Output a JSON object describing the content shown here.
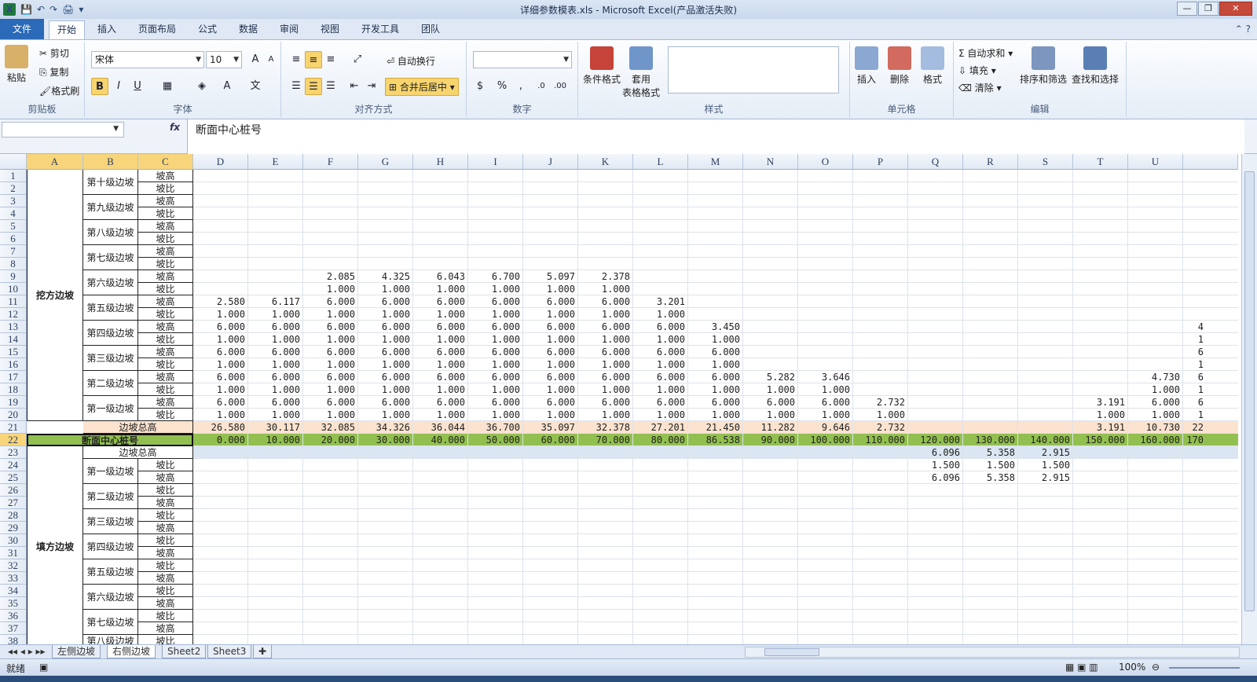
{
  "window": {
    "title": "详细参数模表.xls  -  Microsoft Excel(产品激活失败)"
  },
  "tabs": [
    "文件",
    "开始",
    "插入",
    "页面布局",
    "公式",
    "数据",
    "审阅",
    "视图",
    "开发工具",
    "团队"
  ],
  "ribbon": {
    "clipboard": {
      "name": "剪贴板",
      "paste": "粘贴",
      "cut": "剪切",
      "copy": "复制",
      "format_painter": "格式刷"
    },
    "font": {
      "name": "字体",
      "face": "宋体",
      "size": "10"
    },
    "alignment": {
      "name": "对齐方式",
      "wrap": "自动换行",
      "merge": "合并后居中"
    },
    "number": {
      "name": "数字"
    },
    "styles": {
      "name": "样式",
      "conditional": "条件格式",
      "table_fmt": "套用",
      "table_fmt2": "表格格式"
    },
    "cells": {
      "name": "单元格",
      "insert": "插入",
      "delete": "删除",
      "format": "格式"
    },
    "editing": {
      "name": "编辑",
      "autosum": "自动求和",
      "fill": "填充",
      "clear": "清除",
      "sort": "排序和筛选",
      "find": "查找和选择"
    }
  },
  "formula_bar": {
    "fx": "fx",
    "content": "断面中心桩号"
  },
  "columns": [
    "A",
    "B",
    "C",
    "D",
    "E",
    "F",
    "G",
    "H",
    "I",
    "J",
    "K",
    "L",
    "M",
    "N",
    "O",
    "P",
    "Q",
    "R",
    "S",
    "T",
    "U"
  ],
  "labels": {
    "cut_slope": "挖方边坡",
    "fill_slope": "填方边坡",
    "center_station": "断面中心桩号",
    "total_height": "边坡总高",
    "slope_height": "坡高",
    "slope_ratio": "坡比",
    "cut_levels": [
      "第十级边坡",
      "第九级边坡",
      "第八级边坡",
      "第七级边坡",
      "第六级边坡",
      "第五级边坡",
      "第四级边坡",
      "第三级边坡",
      "第二级边坡",
      "第一级边坡"
    ],
    "fill_levels": [
      "第一级边坡",
      "第二级边坡",
      "第三级边坡",
      "第四级边坡",
      "第五级边坡",
      "第六级边坡",
      "第七级边坡",
      "第八级边坡"
    ]
  },
  "cells": [
    {
      "r": 9,
      "c": "F",
      "v": "2.085"
    },
    {
      "r": 9,
      "c": "G",
      "v": "4.325"
    },
    {
      "r": 9,
      "c": "H",
      "v": "6.043"
    },
    {
      "r": 9,
      "c": "I",
      "v": "6.700"
    },
    {
      "r": 9,
      "c": "J",
      "v": "5.097"
    },
    {
      "r": 9,
      "c": "K",
      "v": "2.378"
    },
    {
      "r": 10,
      "c": "F",
      "v": "1.000"
    },
    {
      "r": 10,
      "c": "G",
      "v": "1.000"
    },
    {
      "r": 10,
      "c": "H",
      "v": "1.000"
    },
    {
      "r": 10,
      "c": "I",
      "v": "1.000"
    },
    {
      "r": 10,
      "c": "J",
      "v": "1.000"
    },
    {
      "r": 10,
      "c": "K",
      "v": "1.000"
    },
    {
      "r": 11,
      "c": "D",
      "v": "2.580"
    },
    {
      "r": 11,
      "c": "E",
      "v": "6.117"
    },
    {
      "r": 11,
      "c": "F",
      "v": "6.000"
    },
    {
      "r": 11,
      "c": "G",
      "v": "6.000"
    },
    {
      "r": 11,
      "c": "H",
      "v": "6.000"
    },
    {
      "r": 11,
      "c": "I",
      "v": "6.000"
    },
    {
      "r": 11,
      "c": "J",
      "v": "6.000"
    },
    {
      "r": 11,
      "c": "K",
      "v": "6.000"
    },
    {
      "r": 11,
      "c": "L",
      "v": "3.201"
    },
    {
      "r": 12,
      "c": "D",
      "v": "1.000"
    },
    {
      "r": 12,
      "c": "E",
      "v": "1.000"
    },
    {
      "r": 12,
      "c": "F",
      "v": "1.000"
    },
    {
      "r": 12,
      "c": "G",
      "v": "1.000"
    },
    {
      "r": 12,
      "c": "H",
      "v": "1.000"
    },
    {
      "r": 12,
      "c": "I",
      "v": "1.000"
    },
    {
      "r": 12,
      "c": "J",
      "v": "1.000"
    },
    {
      "r": 12,
      "c": "K",
      "v": "1.000"
    },
    {
      "r": 12,
      "c": "L",
      "v": "1.000"
    },
    {
      "r": 13,
      "c": "D",
      "v": "6.000"
    },
    {
      "r": 13,
      "c": "E",
      "v": "6.000"
    },
    {
      "r": 13,
      "c": "F",
      "v": "6.000"
    },
    {
      "r": 13,
      "c": "G",
      "v": "6.000"
    },
    {
      "r": 13,
      "c": "H",
      "v": "6.000"
    },
    {
      "r": 13,
      "c": "I",
      "v": "6.000"
    },
    {
      "r": 13,
      "c": "J",
      "v": "6.000"
    },
    {
      "r": 13,
      "c": "K",
      "v": "6.000"
    },
    {
      "r": 13,
      "c": "L",
      "v": "6.000"
    },
    {
      "r": 13,
      "c": "M",
      "v": "3.450"
    },
    {
      "r": 14,
      "c": "D",
      "v": "1.000"
    },
    {
      "r": 14,
      "c": "E",
      "v": "1.000"
    },
    {
      "r": 14,
      "c": "F",
      "v": "1.000"
    },
    {
      "r": 14,
      "c": "G",
      "v": "1.000"
    },
    {
      "r": 14,
      "c": "H",
      "v": "1.000"
    },
    {
      "r": 14,
      "c": "I",
      "v": "1.000"
    },
    {
      "r": 14,
      "c": "J",
      "v": "1.000"
    },
    {
      "r": 14,
      "c": "K",
      "v": "1.000"
    },
    {
      "r": 14,
      "c": "L",
      "v": "1.000"
    },
    {
      "r": 14,
      "c": "M",
      "v": "1.000"
    },
    {
      "r": 15,
      "c": "D",
      "v": "6.000"
    },
    {
      "r": 15,
      "c": "E",
      "v": "6.000"
    },
    {
      "r": 15,
      "c": "F",
      "v": "6.000"
    },
    {
      "r": 15,
      "c": "G",
      "v": "6.000"
    },
    {
      "r": 15,
      "c": "H",
      "v": "6.000"
    },
    {
      "r": 15,
      "c": "I",
      "v": "6.000"
    },
    {
      "r": 15,
      "c": "J",
      "v": "6.000"
    },
    {
      "r": 15,
      "c": "K",
      "v": "6.000"
    },
    {
      "r": 15,
      "c": "L",
      "v": "6.000"
    },
    {
      "r": 15,
      "c": "M",
      "v": "6.000"
    },
    {
      "r": 16,
      "c": "D",
      "v": "1.000"
    },
    {
      "r": 16,
      "c": "E",
      "v": "1.000"
    },
    {
      "r": 16,
      "c": "F",
      "v": "1.000"
    },
    {
      "r": 16,
      "c": "G",
      "v": "1.000"
    },
    {
      "r": 16,
      "c": "H",
      "v": "1.000"
    },
    {
      "r": 16,
      "c": "I",
      "v": "1.000"
    },
    {
      "r": 16,
      "c": "J",
      "v": "1.000"
    },
    {
      "r": 16,
      "c": "K",
      "v": "1.000"
    },
    {
      "r": 16,
      "c": "L",
      "v": "1.000"
    },
    {
      "r": 16,
      "c": "M",
      "v": "1.000"
    },
    {
      "r": 17,
      "c": "D",
      "v": "6.000"
    },
    {
      "r": 17,
      "c": "E",
      "v": "6.000"
    },
    {
      "r": 17,
      "c": "F",
      "v": "6.000"
    },
    {
      "r": 17,
      "c": "G",
      "v": "6.000"
    },
    {
      "r": 17,
      "c": "H",
      "v": "6.000"
    },
    {
      "r": 17,
      "c": "I",
      "v": "6.000"
    },
    {
      "r": 17,
      "c": "J",
      "v": "6.000"
    },
    {
      "r": 17,
      "c": "K",
      "v": "6.000"
    },
    {
      "r": 17,
      "c": "L",
      "v": "6.000"
    },
    {
      "r": 17,
      "c": "M",
      "v": "6.000"
    },
    {
      "r": 17,
      "c": "N",
      "v": "5.282"
    },
    {
      "r": 17,
      "c": "O",
      "v": "3.646"
    },
    {
      "r": 17,
      "c": "U",
      "v": "4.730"
    },
    {
      "r": 18,
      "c": "D",
      "v": "1.000"
    },
    {
      "r": 18,
      "c": "E",
      "v": "1.000"
    },
    {
      "r": 18,
      "c": "F",
      "v": "1.000"
    },
    {
      "r": 18,
      "c": "G",
      "v": "1.000"
    },
    {
      "r": 18,
      "c": "H",
      "v": "1.000"
    },
    {
      "r": 18,
      "c": "I",
      "v": "1.000"
    },
    {
      "r": 18,
      "c": "J",
      "v": "1.000"
    },
    {
      "r": 18,
      "c": "K",
      "v": "1.000"
    },
    {
      "r": 18,
      "c": "L",
      "v": "1.000"
    },
    {
      "r": 18,
      "c": "M",
      "v": "1.000"
    },
    {
      "r": 18,
      "c": "N",
      "v": "1.000"
    },
    {
      "r": 18,
      "c": "O",
      "v": "1.000"
    },
    {
      "r": 18,
      "c": "U",
      "v": "1.000"
    },
    {
      "r": 19,
      "c": "D",
      "v": "6.000"
    },
    {
      "r": 19,
      "c": "E",
      "v": "6.000"
    },
    {
      "r": 19,
      "c": "F",
      "v": "6.000"
    },
    {
      "r": 19,
      "c": "G",
      "v": "6.000"
    },
    {
      "r": 19,
      "c": "H",
      "v": "6.000"
    },
    {
      "r": 19,
      "c": "I",
      "v": "6.000"
    },
    {
      "r": 19,
      "c": "J",
      "v": "6.000"
    },
    {
      "r": 19,
      "c": "K",
      "v": "6.000"
    },
    {
      "r": 19,
      "c": "L",
      "v": "6.000"
    },
    {
      "r": 19,
      "c": "M",
      "v": "6.000"
    },
    {
      "r": 19,
      "c": "N",
      "v": "6.000"
    },
    {
      "r": 19,
      "c": "O",
      "v": "6.000"
    },
    {
      "r": 19,
      "c": "P",
      "v": "2.732"
    },
    {
      "r": 19,
      "c": "T",
      "v": "3.191"
    },
    {
      "r": 19,
      "c": "U",
      "v": "6.000"
    },
    {
      "r": 20,
      "c": "D",
      "v": "1.000"
    },
    {
      "r": 20,
      "c": "E",
      "v": "1.000"
    },
    {
      "r": 20,
      "c": "F",
      "v": "1.000"
    },
    {
      "r": 20,
      "c": "G",
      "v": "1.000"
    },
    {
      "r": 20,
      "c": "H",
      "v": "1.000"
    },
    {
      "r": 20,
      "c": "I",
      "v": "1.000"
    },
    {
      "r": 20,
      "c": "J",
      "v": "1.000"
    },
    {
      "r": 20,
      "c": "K",
      "v": "1.000"
    },
    {
      "r": 20,
      "c": "L",
      "v": "1.000"
    },
    {
      "r": 20,
      "c": "M",
      "v": "1.000"
    },
    {
      "r": 20,
      "c": "N",
      "v": "1.000"
    },
    {
      "r": 20,
      "c": "O",
      "v": "1.000"
    },
    {
      "r": 20,
      "c": "P",
      "v": "1.000"
    },
    {
      "r": 20,
      "c": "T",
      "v": "1.000"
    },
    {
      "r": 20,
      "c": "U",
      "v": "1.000"
    },
    {
      "r": 21,
      "c": "D",
      "v": "26.580"
    },
    {
      "r": 21,
      "c": "E",
      "v": "30.117"
    },
    {
      "r": 21,
      "c": "F",
      "v": "32.085"
    },
    {
      "r": 21,
      "c": "G",
      "v": "34.326"
    },
    {
      "r": 21,
      "c": "H",
      "v": "36.044"
    },
    {
      "r": 21,
      "c": "I",
      "v": "36.700"
    },
    {
      "r": 21,
      "c": "J",
      "v": "35.097"
    },
    {
      "r": 21,
      "c": "K",
      "v": "32.378"
    },
    {
      "r": 21,
      "c": "L",
      "v": "27.201"
    },
    {
      "r": 21,
      "c": "M",
      "v": "21.450"
    },
    {
      "r": 21,
      "c": "N",
      "v": "11.282"
    },
    {
      "r": 21,
      "c": "O",
      "v": "9.646"
    },
    {
      "r": 21,
      "c": "P",
      "v": "2.732"
    },
    {
      "r": 21,
      "c": "T",
      "v": "3.191"
    },
    {
      "r": 21,
      "c": "U",
      "v": "10.730"
    },
    {
      "r": 22,
      "c": "D",
      "v": "0.000"
    },
    {
      "r": 22,
      "c": "E",
      "v": "10.000"
    },
    {
      "r": 22,
      "c": "F",
      "v": "20.000"
    },
    {
      "r": 22,
      "c": "G",
      "v": "30.000"
    },
    {
      "r": 22,
      "c": "H",
      "v": "40.000"
    },
    {
      "r": 22,
      "c": "I",
      "v": "50.000"
    },
    {
      "r": 22,
      "c": "J",
      "v": "60.000"
    },
    {
      "r": 22,
      "c": "K",
      "v": "70.000"
    },
    {
      "r": 22,
      "c": "L",
      "v": "80.000"
    },
    {
      "r": 22,
      "c": "M",
      "v": "86.538"
    },
    {
      "r": 22,
      "c": "N",
      "v": "90.000"
    },
    {
      "r": 22,
      "c": "O",
      "v": "100.000"
    },
    {
      "r": 22,
      "c": "P",
      "v": "110.000"
    },
    {
      "r": 22,
      "c": "Q",
      "v": "120.000"
    },
    {
      "r": 22,
      "c": "R",
      "v": "130.000"
    },
    {
      "r": 22,
      "c": "S",
      "v": "140.000"
    },
    {
      "r": 22,
      "c": "T",
      "v": "150.000"
    },
    {
      "r": 22,
      "c": "U",
      "v": "160.000"
    },
    {
      "r": 23,
      "c": "Q",
      "v": "6.096"
    },
    {
      "r": 23,
      "c": "R",
      "v": "5.358"
    },
    {
      "r": 23,
      "c": "S",
      "v": "2.915"
    },
    {
      "r": 24,
      "c": "Q",
      "v": "1.500"
    },
    {
      "r": 24,
      "c": "R",
      "v": "1.500"
    },
    {
      "r": 24,
      "c": "S",
      "v": "1.500"
    },
    {
      "r": 25,
      "c": "Q",
      "v": "6.096"
    },
    {
      "r": 25,
      "c": "R",
      "v": "5.358"
    },
    {
      "r": 25,
      "c": "S",
      "v": "2.915"
    }
  ],
  "clipped_right": [
    {
      "r": 13,
      "v": "4"
    },
    {
      "r": 14,
      "v": "1"
    },
    {
      "r": 15,
      "v": "6"
    },
    {
      "r": 16,
      "v": "1"
    },
    {
      "r": 17,
      "v": "6"
    },
    {
      "r": 18,
      "v": "1"
    },
    {
      "r": 19,
      "v": "6"
    },
    {
      "r": 20,
      "v": "1"
    },
    {
      "r": 21,
      "v": "22"
    },
    {
      "r": 22,
      "v": "170"
    }
  ],
  "sheets": [
    "左侧边坡",
    "右侧边坡",
    "Sheet2",
    "Sheet3"
  ],
  "status": {
    "ready": "就绪",
    "zoom": "100%"
  },
  "colors": {
    "row21": "#fbe3cf",
    "row22": "#92c050",
    "row23": "#dae6f1",
    "selection": "#f8d57a"
  }
}
